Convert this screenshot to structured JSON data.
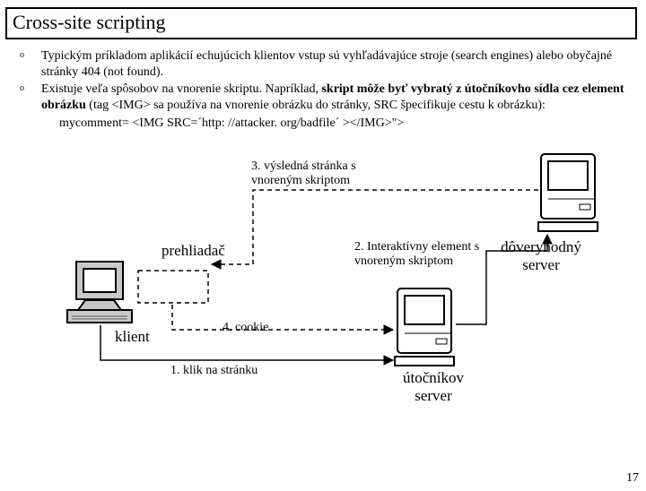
{
  "title": "Cross-site scripting",
  "bullets": [
    {
      "plain": "Typickým príkladom aplikácií echujúcich klientov vstup sú vyhľadávajúce stroje (search engines) alebo obyčajné stránky 404 (not found)."
    },
    {
      "before": "Existuje veľa spôsobov na vnorenie skriptu. Napríklad, ",
      "bold": "skript môže byť vybratý z útočníkovho sídla cez element obrázku",
      "after": " (tag <IMG> sa používa na vnorenie obrázku do stránky, SRC špecifikuje cestu k obrázku):"
    }
  ],
  "code": "mycomment= <IMG SRC=´http: //attacker. org/badfile´ ></IMG>\">",
  "labels": {
    "step3": "3. výsledná stránka s vnoreným skriptom",
    "browser": "prehliadač",
    "step2": "2. Interaktívny element s vnoreným skriptom",
    "trusted": "dôveryhodný server",
    "client": "klient",
    "step4": "4. cookie",
    "step1": "1. klik na stránku",
    "attacker": "útočníkov server"
  },
  "page_number": "17"
}
